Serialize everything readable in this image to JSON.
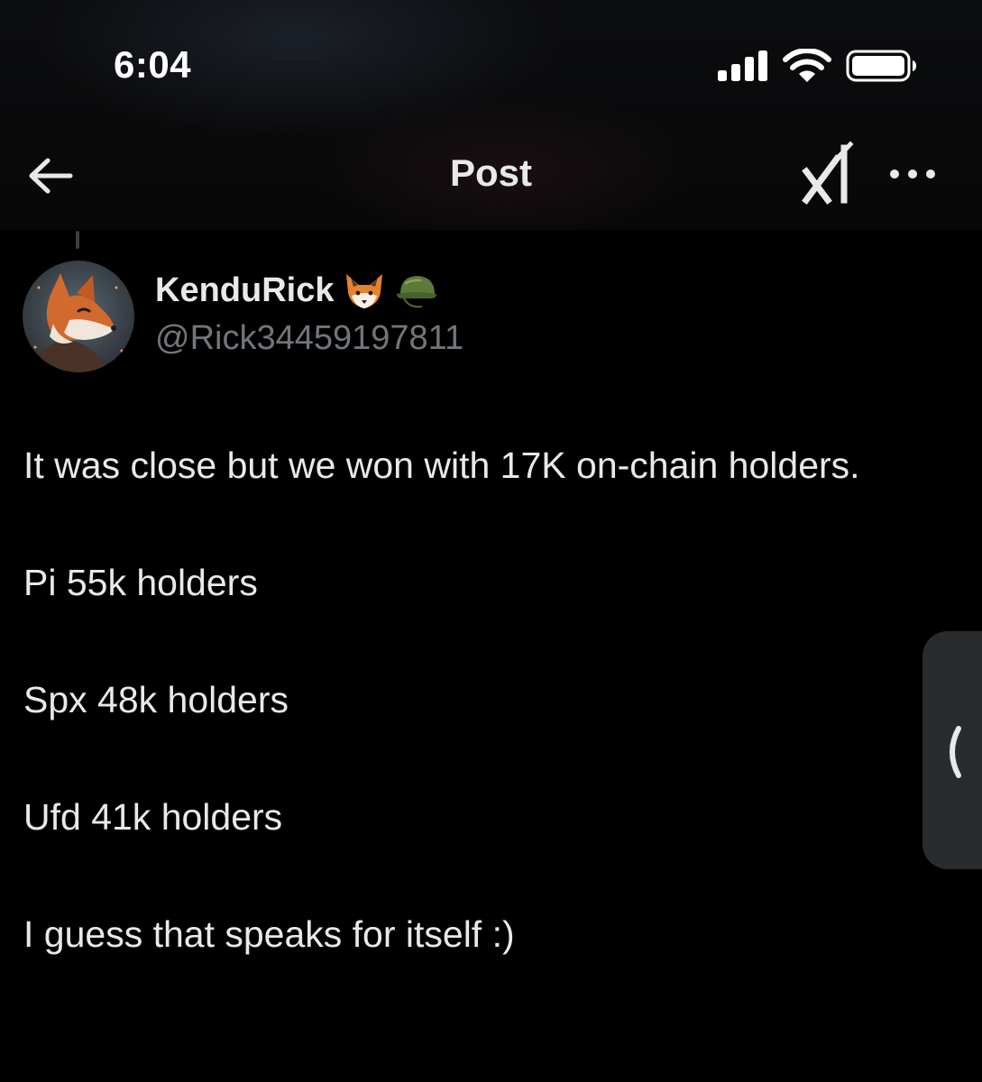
{
  "status_bar": {
    "time": "6:04",
    "icons": [
      "cellular-signal-icon",
      "wifi-icon",
      "battery-icon"
    ]
  },
  "nav": {
    "title": "Post",
    "back_icon": "back-arrow-icon",
    "grok_icon": "grok-icon",
    "more_icon": "more-horizontal-icon"
  },
  "author": {
    "name": "KenduRick",
    "name_emojis": [
      "fox-emoji",
      "military-helmet-emoji"
    ],
    "handle": "@Rick34459197811",
    "avatar": "fox-avatar"
  },
  "post": {
    "paragraphs": [
      "It was close but we won with 17K on-chain holders.",
      "Pi 55k holders",
      "Spx 48k holders",
      "Ufd 41k holders",
      "I guess that speaks for itself :)"
    ]
  },
  "side_handle": {
    "icon": "chevron-left-icon"
  },
  "colors": {
    "background": "#000000",
    "text_primary": "#e7e9ea",
    "text_secondary": "#71767b",
    "handle_panel": "#2a2b2d"
  }
}
